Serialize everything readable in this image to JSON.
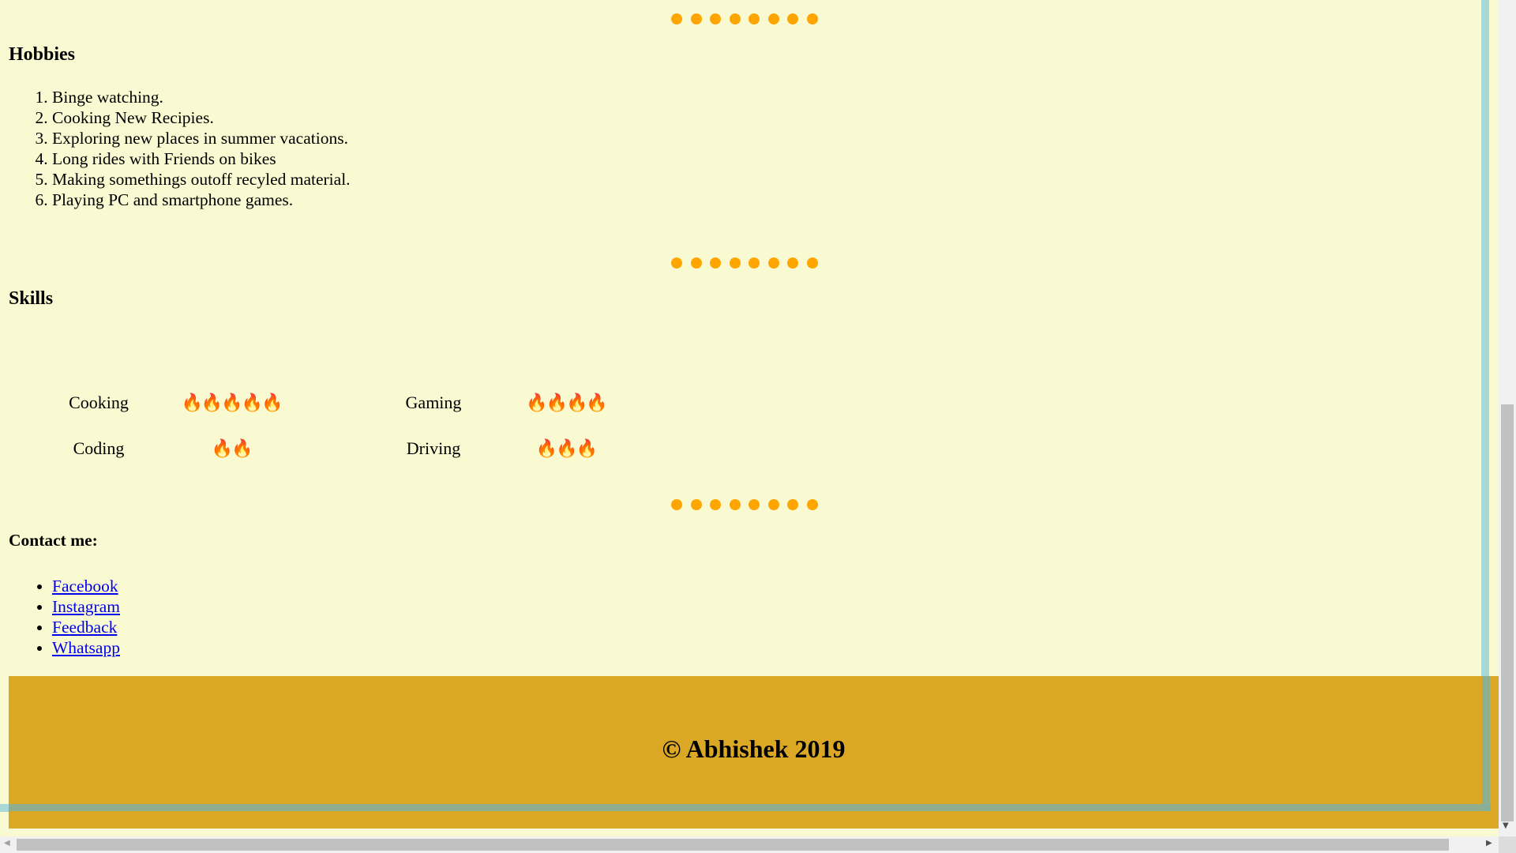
{
  "hobbies": {
    "title": "Hobbies",
    "items": [
      "Binge watching.",
      "Cooking New Recipies.",
      "Exploring new places in summer vacations.",
      "Long rides with Friends on bikes",
      "Making somethings outoff recyled material.",
      "Playing PC and smartphone games."
    ]
  },
  "skills": {
    "title": "Skills",
    "rating_icon": "fire-icon",
    "rows": [
      [
        {
          "name": "Cooking",
          "rating": 5,
          "flames": "🔥🔥🔥🔥🔥"
        },
        {
          "name": "Gaming",
          "rating": 4,
          "flames": "🔥🔥🔥🔥"
        }
      ],
      [
        {
          "name": "Coding",
          "rating": 2,
          "flames": "🔥🔥"
        },
        {
          "name": "Driving",
          "rating": 3,
          "flames": "🔥🔥🔥"
        }
      ]
    ]
  },
  "separator": {
    "dot_count": 8,
    "color": "#ffa500"
  },
  "contact": {
    "title": "Contact me:",
    "links": [
      "Facebook",
      "Instagram",
      "Feedback",
      "Whatsapp"
    ]
  },
  "footer": {
    "text": "© Abhishek 2019",
    "color": "#daa520"
  },
  "colors": {
    "background": "#fafad2",
    "frame": "#a8d8d8",
    "link": "#0000ee"
  }
}
